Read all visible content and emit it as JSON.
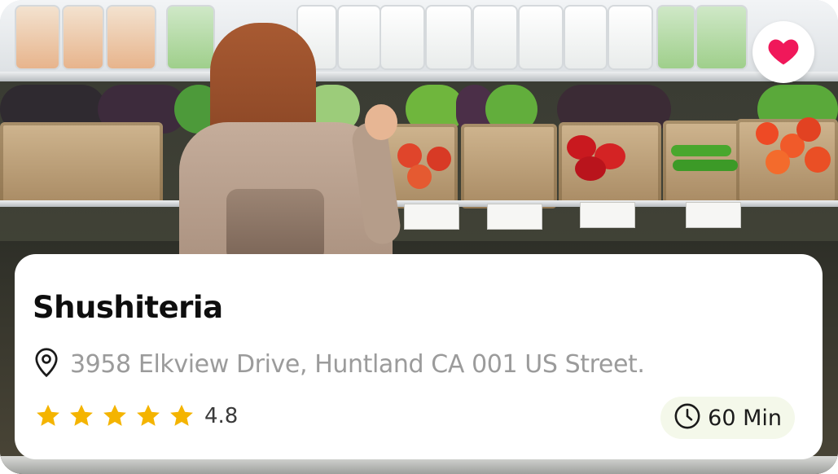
{
  "restaurant": {
    "name": "Shushiteria",
    "address": "3958 Elkview Drive, Huntland CA 001 US Street.",
    "rating": "4.8",
    "stars": 5,
    "delivery_time": "60 Min"
  },
  "favorite": {
    "state": "liked",
    "color": "#f0185a"
  },
  "colors": {
    "star": "#f4b400",
    "time_pill_bg": "#f4f8ea",
    "address_text": "#9b9b9b"
  },
  "icons": {
    "favorite": "heart-icon",
    "location": "location-pin-icon",
    "rating": "star-icon",
    "time": "clock-icon"
  }
}
